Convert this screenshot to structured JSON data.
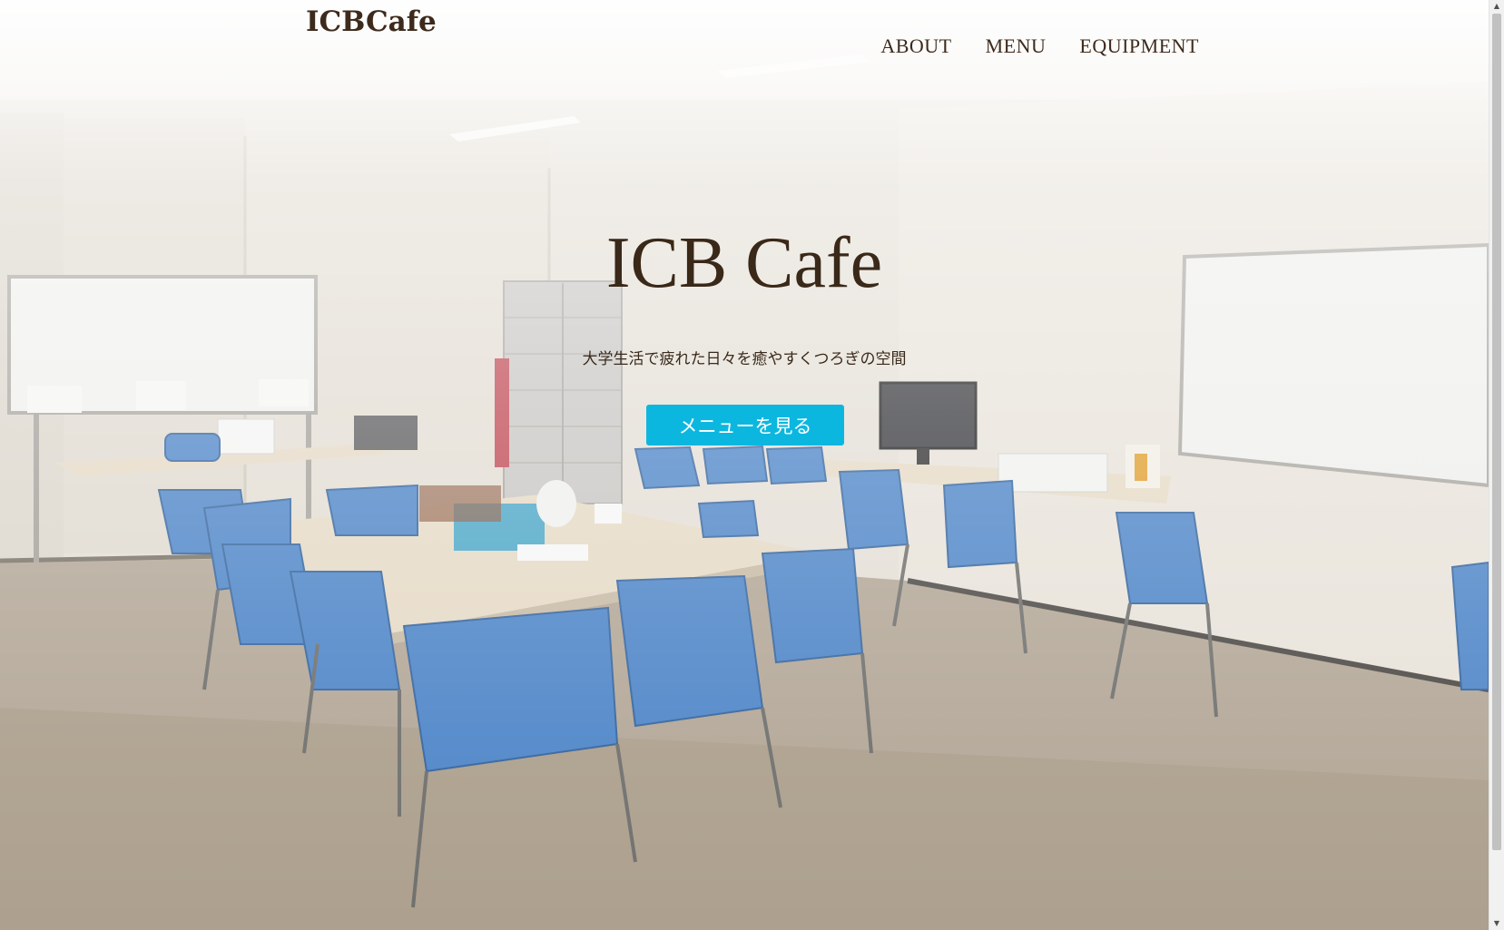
{
  "header": {
    "logo": "ICBCafe",
    "nav": [
      {
        "label": "ABOUT"
      },
      {
        "label": "MENU"
      },
      {
        "label": "EQUIPMENT"
      }
    ]
  },
  "hero": {
    "title": "ICB Cafe",
    "subtitle": "大学生活で疲れた日々を癒やすくつろぎの空間",
    "button_label": "メニューを見る",
    "background": "cafe-room-photo"
  },
  "colors": {
    "text_brown": "#3d2a1c",
    "button_cyan": "#0cb7df",
    "chair_blue": "#4f86c8",
    "table_beige": "#e6dac6"
  },
  "scrollbar": {
    "up_icon": "▲",
    "down_icon": "▼"
  }
}
